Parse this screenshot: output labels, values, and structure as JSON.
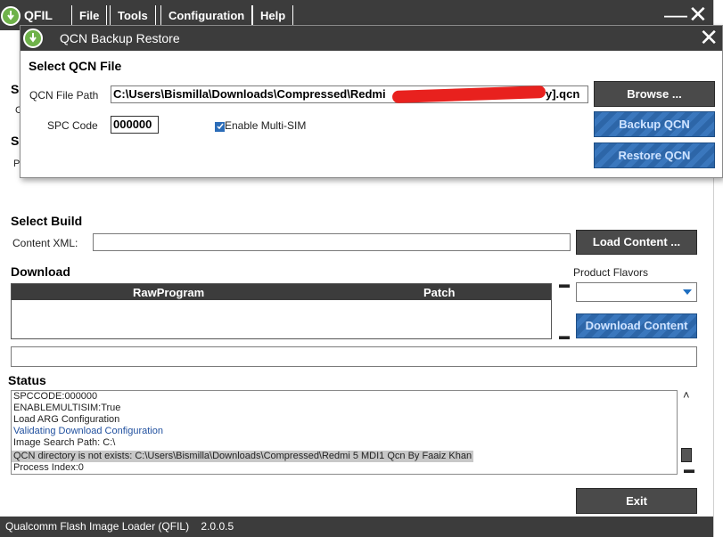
{
  "main": {
    "app_name": "QFIL",
    "menu": [
      "File",
      "Tools",
      "Configuration",
      "Help"
    ],
    "minimize": "—",
    "close": "✕"
  },
  "dialog": {
    "title": "QCN Backup Restore",
    "heading": "Select QCN File",
    "qcn_path_label": "QCN File Path",
    "qcn_path_value": "C:\\Users\\Bismilla\\Downloads\\Compressed\\Redmi",
    "qcn_path_suffix": "y].qcn",
    "spc_label": "SPC Code",
    "spc_value": "000000",
    "multisim_label": "Enable Multi-SIM",
    "multisim_checked": true,
    "browse": "Browse ...",
    "backup": "Backup QCN",
    "restore": "Restore QCN",
    "close": "✕"
  },
  "hidden_left": {
    "s1": "S",
    "c1": "C",
    "s2": "S",
    "p1": "P"
  },
  "build": {
    "heading": "Select Build",
    "content_xml_label": "Content XML:",
    "content_xml_value": "",
    "load_content": "Load Content ..."
  },
  "download": {
    "heading": "Download",
    "col_rawprogram": "RawProgram",
    "col_patch": "Patch",
    "product_flavors_label": "Product Flavors",
    "product_flavors_value": "",
    "download_content": "Download Content",
    "path_value": ""
  },
  "status": {
    "heading": "Status",
    "lines": [
      {
        "text": "SPCCODE:000000",
        "style": "normal"
      },
      {
        "text": "ENABLEMULTISIM:True",
        "style": "normal"
      },
      {
        "text": "Load ARG Configuration",
        "style": "normal"
      },
      {
        "text": "Validating Download Configuration",
        "style": "blue"
      },
      {
        "text": "Image Search Path: C:\\",
        "style": "normal"
      },
      {
        "text": "QCN directory is not exists: C:\\Users\\Bismilla\\Downloads\\Compressed\\Redmi 5 MDI1 Qcn By Faaiz Khan",
        "style": "hl"
      },
      {
        "text": "Process Index:0",
        "style": "normal"
      }
    ],
    "exit": "Exit"
  },
  "footer": {
    "app_full_name": "Qualcomm Flash Image Loader (QFIL)",
    "version": "2.0.0.5"
  },
  "colors": {
    "chrome": "#3c3c3c",
    "accent_blue": "#2d66a8",
    "logo_green": "#6fb24a",
    "redaction": "#e8211e"
  }
}
